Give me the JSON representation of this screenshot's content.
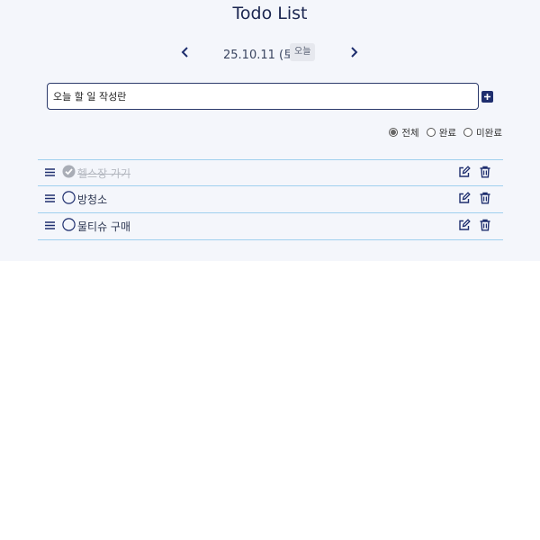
{
  "app": {
    "title": "Todo List"
  },
  "date_nav": {
    "date": "25.10.11 (토)",
    "today_label": "오늘",
    "prev_icon": "chevron-left-icon",
    "next_icon": "chevron-right-icon"
  },
  "input": {
    "placeholder": "오늘 할 일 작성란",
    "value": "",
    "add_icon": "plus-square-icon"
  },
  "filters": {
    "selected": "전체",
    "options": [
      {
        "label": "전체",
        "checked": true
      },
      {
        "label": "완료",
        "checked": false
      },
      {
        "label": "미완료",
        "checked": false
      }
    ]
  },
  "todos": [
    {
      "text": "헬스장 가기",
      "done": true
    },
    {
      "text": "방청소",
      "done": false
    },
    {
      "text": "물티슈 구매",
      "done": false
    }
  ],
  "colors": {
    "background": "#f4f6fb",
    "accent": "#1e2e6e",
    "divider": "#9fd0ee",
    "done_text": "#b4b8c0"
  }
}
